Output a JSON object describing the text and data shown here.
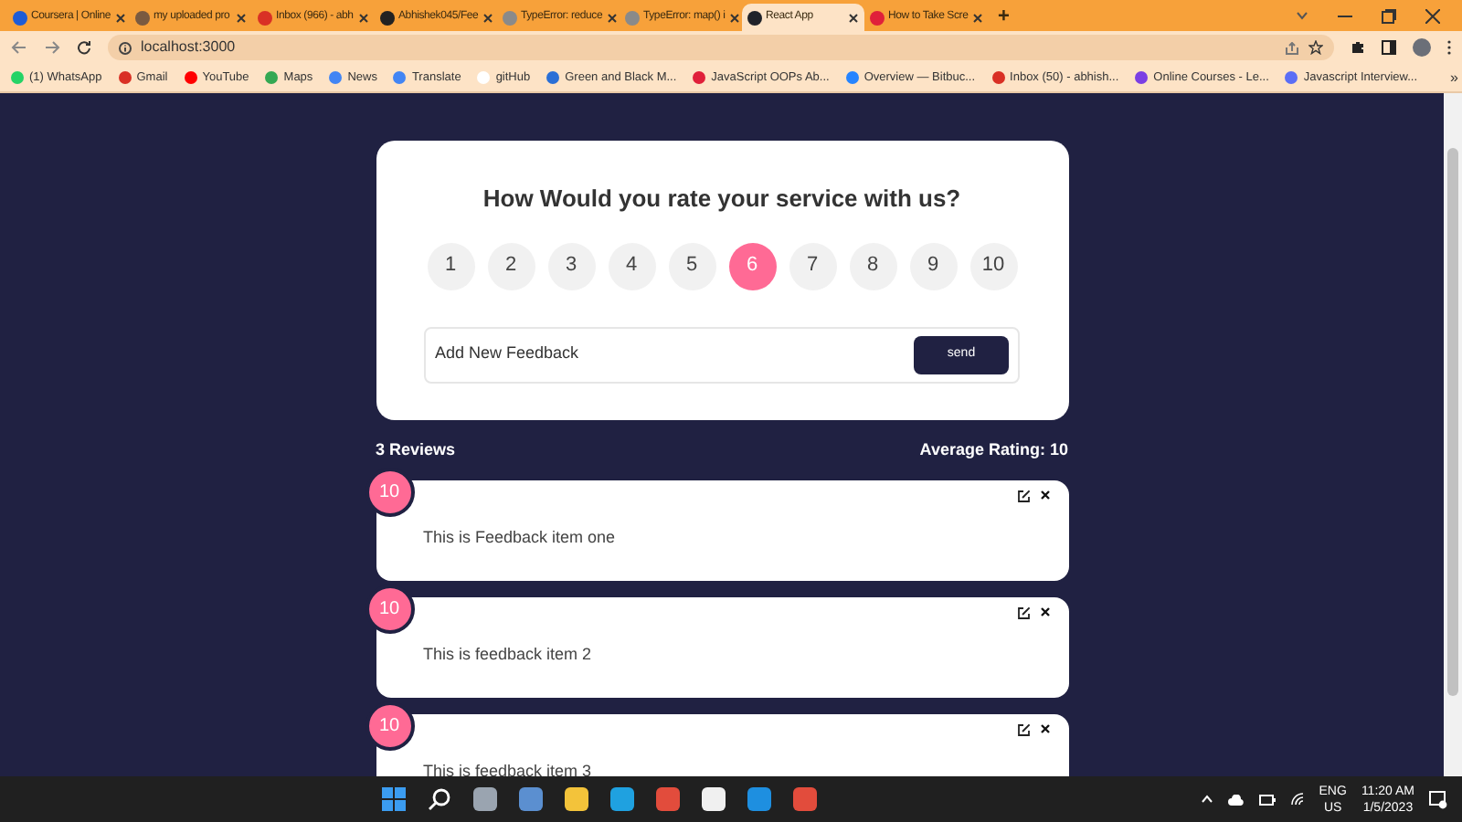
{
  "browser": {
    "tabs": [
      {
        "title": "Coursera | Online",
        "selected": false,
        "color": "#1f5cd6"
      },
      {
        "title": "my uploaded pro",
        "selected": false,
        "color": "#7a5a40"
      },
      {
        "title": "Inbox (966) - abh",
        "selected": false,
        "color": "#d93025"
      },
      {
        "title": "Abhishek045/Fee",
        "selected": false,
        "color": "#222222"
      },
      {
        "title": "TypeError: reduce",
        "selected": false,
        "color": "#8a8a8a"
      },
      {
        "title": "TypeError: map() i",
        "selected": false,
        "color": "#8a8a8a"
      },
      {
        "title": "React App",
        "selected": true,
        "color": "#20232a"
      },
      {
        "title": "How to Take Scre",
        "selected": false,
        "color": "#e0203a"
      }
    ],
    "new_tab": "+",
    "address": "localhost:3000",
    "bookmarks": [
      {
        "label": "(1) WhatsApp",
        "color": "#25d366"
      },
      {
        "label": "Gmail",
        "color": "#d93025"
      },
      {
        "label": "YouTube",
        "color": "#ff0000"
      },
      {
        "label": "Maps",
        "color": "#34a853"
      },
      {
        "label": "News",
        "color": "#4285f4"
      },
      {
        "label": "Translate",
        "color": "#4285f4"
      },
      {
        "label": "gitHub",
        "color": "#ffffff"
      },
      {
        "label": "Green and Black M...",
        "color": "#2a6fd6"
      },
      {
        "label": "JavaScript OOPs Ab...",
        "color": "#e0203a"
      },
      {
        "label": "Overview — Bitbuc...",
        "color": "#2684ff"
      },
      {
        "label": "Inbox (50) - abhish...",
        "color": "#d93025"
      },
      {
        "label": "Online Courses - Le...",
        "color": "#7b3fe4"
      },
      {
        "label": "Javascript Interview...",
        "color": "#5b6ef5"
      }
    ],
    "bookmarks_more": "»"
  },
  "rating_card": {
    "title": "How Would you rate your service with us?",
    "options": [
      {
        "label": "1",
        "selected": false
      },
      {
        "label": "2",
        "selected": false
      },
      {
        "label": "3",
        "selected": false
      },
      {
        "label": "4",
        "selected": false
      },
      {
        "label": "5",
        "selected": false
      },
      {
        "label": "6",
        "selected": true
      },
      {
        "label": "7",
        "selected": false
      },
      {
        "label": "8",
        "selected": false
      },
      {
        "label": "9",
        "selected": false
      },
      {
        "label": "10",
        "selected": false
      }
    ],
    "input": {
      "placeholder": "Add New Feedback"
    },
    "send": "send"
  },
  "stats": {
    "reviews": "3 Reviews",
    "average": "Average Rating: 10"
  },
  "feedback": [
    {
      "rating": "10",
      "text": "This is Feedback item one"
    },
    {
      "rating": "10",
      "text": "This is feedback item 2"
    },
    {
      "rating": "10",
      "text": "This is feedback item 3"
    }
  ],
  "taskbar": {
    "language": "ENG",
    "region": "US",
    "time": "11:20 AM",
    "date": "1/5/2023"
  }
}
